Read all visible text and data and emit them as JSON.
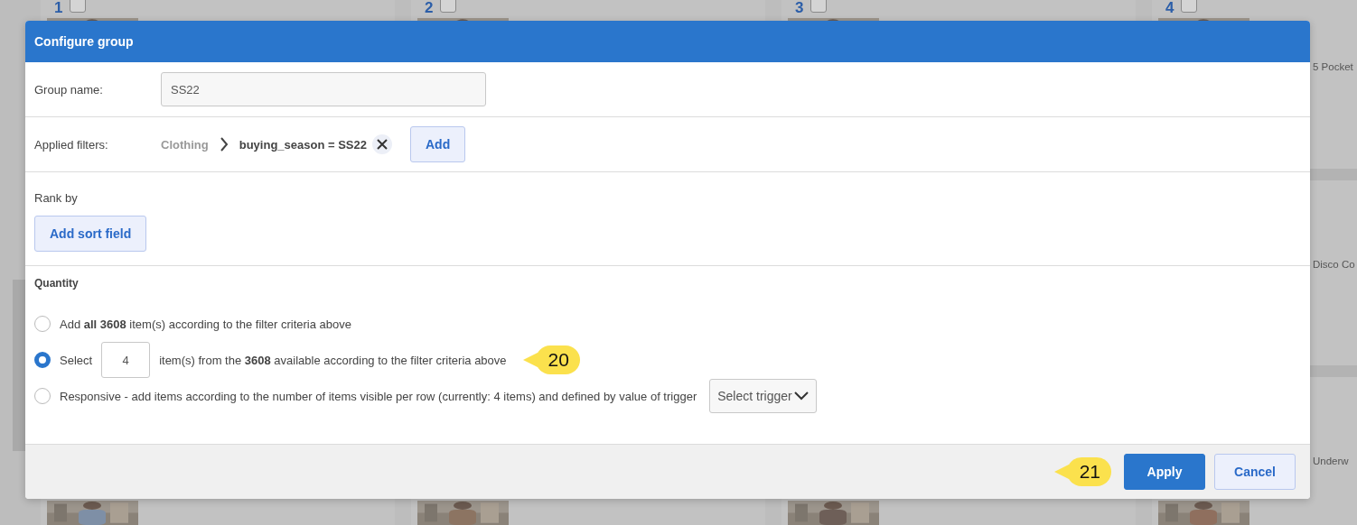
{
  "background": {
    "cards": [
      {
        "number": "1",
        "checked": false
      },
      {
        "number": "2",
        "checked": false
      },
      {
        "number": "3",
        "checked": false
      },
      {
        "number": "4",
        "checked": false
      }
    ],
    "captions": [
      "5 Pocket",
      "Disco Co",
      "Underw"
    ]
  },
  "dialog": {
    "title": "Configure group",
    "group_name": {
      "label": "Group name:",
      "value": "SS22"
    },
    "filters": {
      "label": "Applied filters:",
      "path": [
        {
          "kind": "category",
          "label": "Clothing"
        },
        {
          "kind": "condition",
          "label": "buying_season = SS22"
        }
      ],
      "add_button": "Add"
    },
    "rank_by": {
      "label": "Rank by",
      "button": "Add sort field"
    },
    "quantity": {
      "label": "Quantity",
      "options": [
        {
          "kind": "plain",
          "selected": false,
          "text": "Add **all 3608** item(s) according to the filter criteria above"
        },
        {
          "kind": "count",
          "selected": true,
          "prefix": "Select",
          "value": "4",
          "suffix": "item(s) from the **3608** available according to the filter criteria above",
          "callout": "20"
        },
        {
          "kind": "trigger",
          "selected": false,
          "text": "Responsive - add items according to the number of items visible per row (currently: 4 items) and defined by value of trigger",
          "select_label": "Select trigger"
        }
      ]
    },
    "footer": {
      "callout": "21",
      "buttons": [
        {
          "kind": "primary",
          "label": "Apply"
        },
        {
          "kind": "secondary",
          "label": "Cancel"
        }
      ]
    }
  }
}
